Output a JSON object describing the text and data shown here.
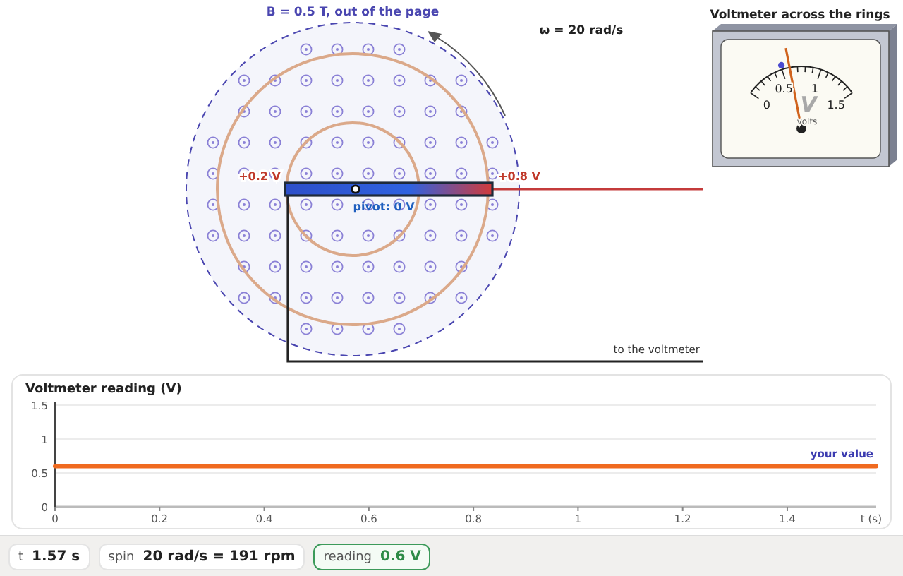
{
  "field": {
    "label": "B = 0.5 T, out of the page"
  },
  "spin_label": "ω = 20 rad/s",
  "rod": {
    "left_label": "+0.2 V",
    "right_label": "+0.8 V",
    "pivot_label": "pivot: 0 V"
  },
  "wire_label": "to the voltmeter",
  "voltmeter": {
    "title": "Voltmeter across the rings",
    "ticks": [
      "0",
      "0.5",
      "1",
      "1.5"
    ],
    "symbol": "V",
    "unit": "volts",
    "needle": {
      "level": 0.4
    },
    "marker": {
      "level": 0.34
    }
  },
  "chart": {
    "chart_data": {
      "type": "line",
      "title": "Voltmeter reading (V)",
      "xlabel": "t (s)",
      "x": [
        0,
        1.57
      ],
      "series": [
        {
          "name": "your value",
          "color": "#f06a1f",
          "values": [
            0.6,
            0.6
          ]
        }
      ],
      "xlim": [
        0,
        1.57
      ],
      "ylim": [
        0,
        1.5
      ],
      "xticks": [
        0,
        0.2,
        0.4,
        0.6,
        0.8,
        1,
        1.2,
        1.4
      ],
      "yticks": [
        0,
        0.5,
        1,
        1.5
      ]
    }
  },
  "status_bar": [
    {
      "label": "t",
      "value": "1.57 s",
      "kind": "plain"
    },
    {
      "label": "spin",
      "value": "20 rad/s = 191 rpm",
      "kind": "plain"
    },
    {
      "label": "reading",
      "value": "0.6 V",
      "kind": "highlight"
    }
  ]
}
